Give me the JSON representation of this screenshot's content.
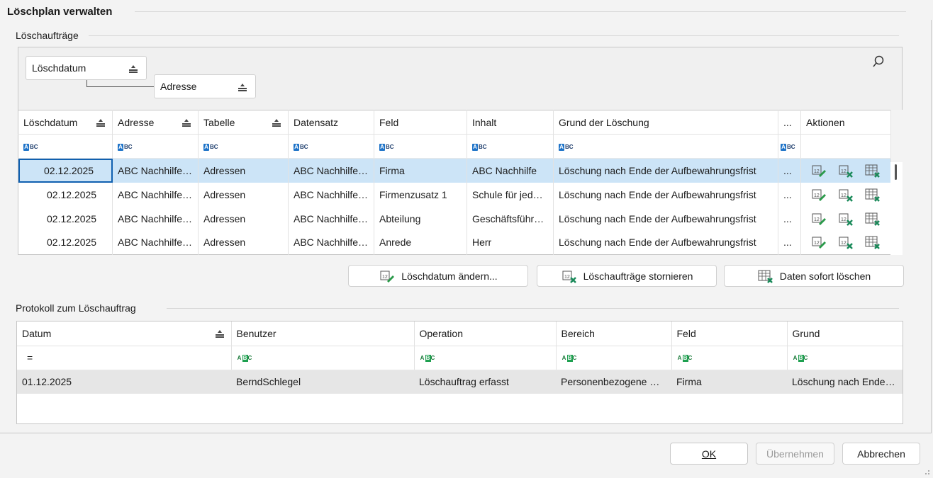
{
  "dialog": {
    "title": "Löschplan verwalten",
    "section1_label": "Löschaufträge",
    "section2_label": "Protokoll zum Löschauftrag"
  },
  "grouping": {
    "chips": [
      "Löschdatum",
      "Adresse"
    ]
  },
  "orders_grid": {
    "headers": [
      "Löschdatum",
      "Adresse",
      "Tabelle",
      "Datensatz",
      "Feld",
      "Inhalt",
      "Grund der Löschung",
      "...",
      "Aktionen"
    ],
    "rows": [
      [
        "02.12.2025",
        "ABC Nachhilfe Schule",
        "Adressen",
        "ABC Nachhilfe Schule",
        "Firma",
        "ABC Nachhilfe",
        "Löschung nach Ende der Aufbewahrungsfrist",
        "..."
      ],
      [
        "02.12.2025",
        "ABC Nachhilfe Schule",
        "Adressen",
        "ABC Nachhilfe Schule",
        "Firmenzusatz 1",
        "Schule für jedermann",
        "Löschung nach Ende der Aufbewahrungsfrist",
        "..."
      ],
      [
        "02.12.2025",
        "ABC Nachhilfe Schule",
        "Adressen",
        "ABC Nachhilfe Schule",
        "Abteilung",
        "Geschäftsführung",
        "Löschung nach Ende der Aufbewahrungsfrist",
        "..."
      ],
      [
        "02.12.2025",
        "ABC Nachhilfe Schule",
        "Adressen",
        "ABC Nachhilfe Schule",
        "Anrede",
        "Herr",
        "Löschung nach Ende der Aufbewahrungsfrist",
        "..."
      ]
    ]
  },
  "order_buttons": {
    "change_date": "Löschdatum ändern...",
    "cancel_orders": "Löschaufträge stornieren",
    "delete_now": "Daten sofort löschen"
  },
  "protocol_grid": {
    "headers": [
      "Datum",
      "Benutzer",
      "Operation",
      "Bereich",
      "Feld",
      "Grund"
    ],
    "filter_date": "=",
    "rows": [
      [
        "01.12.2025",
        "BerndSchlegel",
        "Löschauftrag erfasst",
        "Personenbezogene Daten",
        "Firma",
        "Löschung nach Ende der Aufbewahrungsfrist"
      ]
    ]
  },
  "footer": {
    "ok": "OK",
    "apply": "Übernehmen",
    "cancel": "Abbrechen"
  },
  "colors": {
    "selection": "#cce4f7",
    "focus_border": "#1060b0",
    "abc_blue": "#1e73c8",
    "abc_green": "#1ea050"
  }
}
